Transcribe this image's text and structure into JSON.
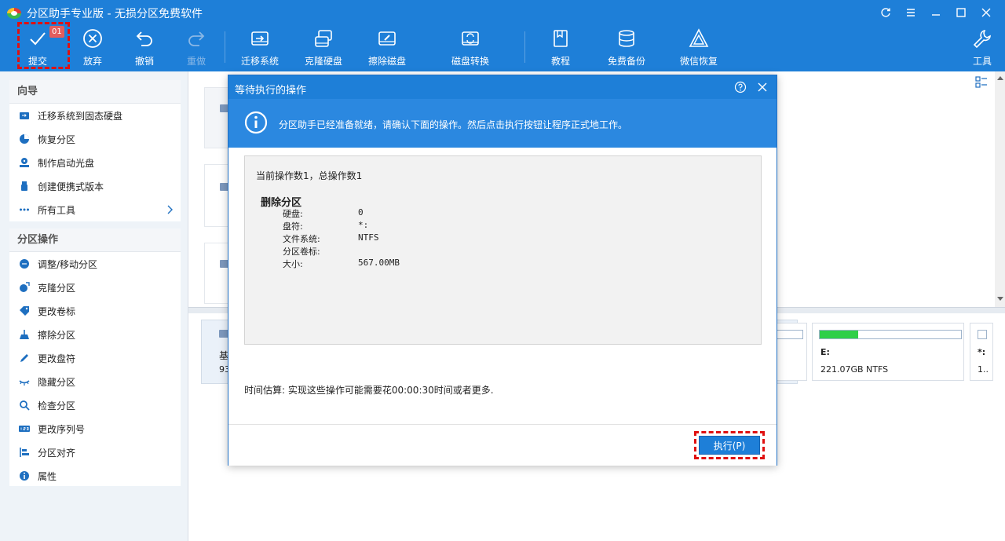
{
  "window": {
    "title": "分区助手专业版 - 无损分区免费软件"
  },
  "toolbar": {
    "submit": {
      "label": "提交",
      "badge": "01"
    },
    "discard": {
      "label": "放弃"
    },
    "undo": {
      "label": "撤销"
    },
    "redo": {
      "label": "重做"
    },
    "migrate": {
      "label": "迁移系统"
    },
    "clone": {
      "label": "克隆硬盘"
    },
    "wipe": {
      "label": "擦除磁盘"
    },
    "convert": {
      "label": "磁盘转换"
    },
    "tutorial": {
      "label": "教程"
    },
    "backup": {
      "label": "免费备份"
    },
    "wechat": {
      "label": "微信恢复"
    },
    "tools": {
      "label": "工具"
    }
  },
  "sidebar": {
    "wizard": {
      "heading": "向导",
      "items": [
        "迁移系统到固态硬盘",
        "恢复分区",
        "制作启动光盘",
        "创建便携式版本",
        "所有工具"
      ]
    },
    "partition_ops": {
      "heading": "分区操作",
      "items": [
        "调整/移动分区",
        "克隆分区",
        "更改卷标",
        "擦除分区",
        "更改盘符",
        "隐藏分区",
        "检查分区",
        "更改序列号",
        "分区对齐",
        "属性"
      ]
    }
  },
  "disk_area": {
    "disk_label": "基",
    "disk_size": "93",
    "partition_e": {
      "letter": "E:",
      "info": "221.07GB NTFS",
      "used_fraction": 0.27
    },
    "partition_star": {
      "letter": "*:",
      "info": "1.."
    }
  },
  "dialog": {
    "title": "等待执行的操作",
    "info": "分区助手已经准备就绪，请确认下面的操作。然后点击执行按钮让程序正式地工作。",
    "op_count": "当前操作数1，总操作数1",
    "operation": {
      "name": "删除分区",
      "rows": [
        {
          "label": "硬盘:",
          "value": "0"
        },
        {
          "label": "盘符:",
          "value": "*:"
        },
        {
          "label": "文件系统:",
          "value": "NTFS"
        },
        {
          "label": "分区卷标:",
          "value": ""
        },
        {
          "label": "大小:",
          "value": "567.00MB"
        }
      ]
    },
    "time_estimate": "时间估算: 实现这些操作可能需要花00:00:30时间或者更多.",
    "execute_label": "执行(P)"
  },
  "colors": {
    "primary": "#1e7fd8",
    "info_band": "#2b88e0",
    "highlight": "#e01010",
    "badge": "#e35d5d",
    "usage_bar": "#2ecf48"
  }
}
